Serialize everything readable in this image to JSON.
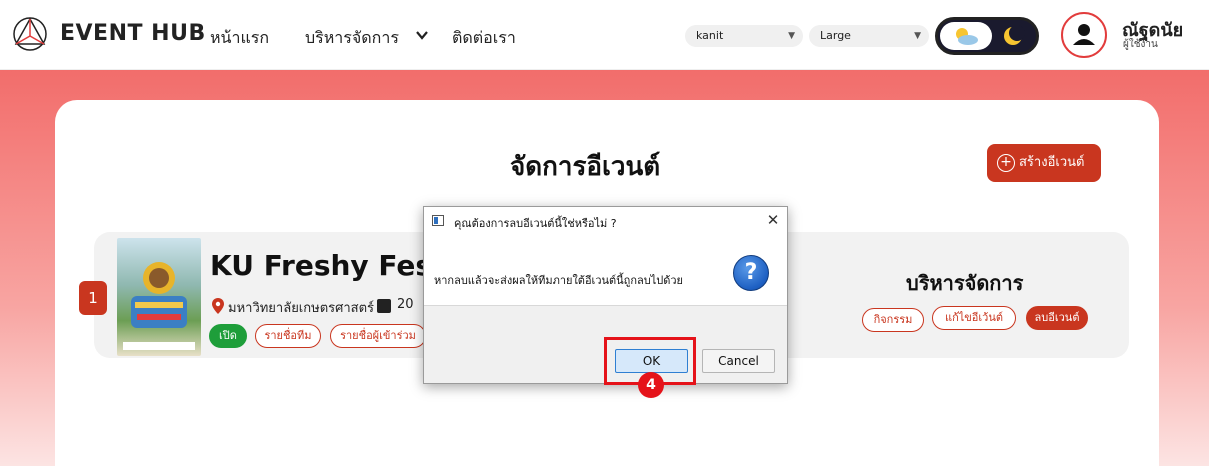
{
  "navbar": {
    "brand": "EVENT HUB",
    "links": {
      "home": "หน้าแรก",
      "manage": "บริหารจัดการ",
      "contact": "ติดต่อเรา"
    },
    "font_select": "kanit",
    "size_select": "Large",
    "user_name": "ณัฐดนัย",
    "user_role": "ผู้ใช้งาน"
  },
  "page": {
    "title": "จัดการอีเวนต์",
    "create_button": "สร้างอีเวนต์"
  },
  "event": {
    "index": "1",
    "title": "KU Freshy Fest",
    "location": "มหาวิทยาลัยเกษตรศาสตร์",
    "date": "20",
    "status": "เปิด",
    "team_list": "รายชื่อทีม",
    "attendee_list": "รายชื่อผู้เข้าร่วม",
    "manage_title": "บริหารจัดการ",
    "activity": "กิจกรรม",
    "edit": "แก้ไขอีเว้นต์",
    "delete": "ลบอีเวนต์"
  },
  "dialog": {
    "title": "คุณต้องการลบอีเวนต์นี้ใช่หรือไม่ ?",
    "message": "หากลบแล้วจะส่งผลให้ทีมภายใต้อีเวนต์นี้ถูกลบไปด้วย",
    "question_glyph": "?",
    "close_glyph": "✕",
    "ok": "OK",
    "cancel": "Cancel"
  },
  "annotation": {
    "step": "4"
  },
  "colors": {
    "accent": "#c9361f",
    "success": "#1e9e3a",
    "highlight": "#e5131a"
  },
  "icons": [
    "logo-icon",
    "chevron-down-icon",
    "sun-cloud-icon",
    "moon-icon",
    "user-icon",
    "plus-circle-icon",
    "pin-icon",
    "calendar-icon",
    "question-icon",
    "close-icon"
  ]
}
